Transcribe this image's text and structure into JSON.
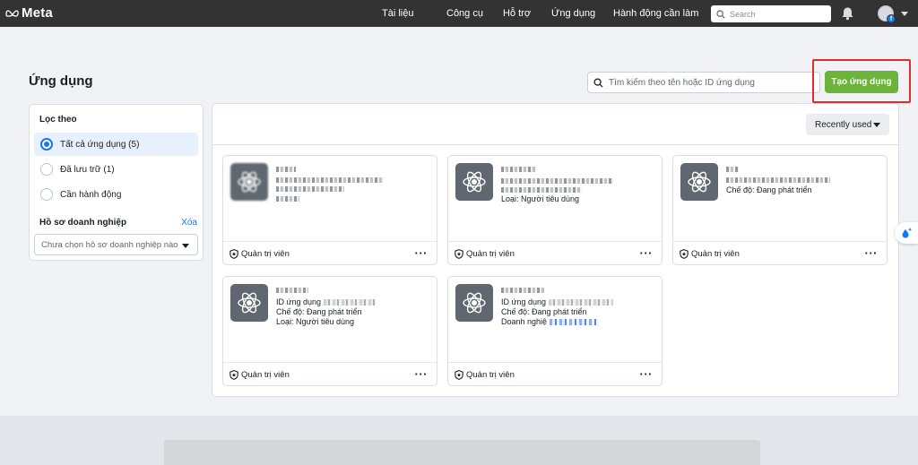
{
  "brand": {
    "name": "Meta"
  },
  "topnav": {
    "links": [
      "Tài liệu",
      "Công cụ",
      "Hỗ trợ",
      "Ứng dụng",
      "Hành động cần làm"
    ],
    "search_placeholder": "Search"
  },
  "page": {
    "title": "Ứng dụng",
    "search_placeholder": "Tìm kiếm theo tên hoặc ID ứng dụng",
    "create_button": "Tạo ứng dụng"
  },
  "filter": {
    "heading": "Lọc theo",
    "options": [
      {
        "label": "Tất cả ứng dụng (5)",
        "selected": true
      },
      {
        "label": "Đã lưu trữ (1)",
        "selected": false
      },
      {
        "label": "Cần hành động",
        "selected": false
      }
    ],
    "business_heading": "Hồ sơ doanh nghiệp",
    "clear_label": "Xóa",
    "business_select": "Chưa chọn hồ sơ doanh nghiệp nào"
  },
  "sort": {
    "label": "Recently used"
  },
  "apps": [
    {
      "lines": [],
      "role": "Quản trị viên"
    },
    {
      "lines": [
        "Loại: Người tiêu dùng"
      ],
      "role": "Quản trị viên"
    },
    {
      "lines": [
        "Chế độ: Đang phát triển"
      ],
      "role": "Quản trị viên"
    },
    {
      "lines": [
        "ID ứng dụng",
        "Chế độ: Đang phát triển",
        "Loại: Người tiêu dùng"
      ],
      "role": "Quản trị viên"
    },
    {
      "lines": [
        "ID ứng dụng",
        "Chế độ: Đang phát triển",
        "Doanh nghiệ"
      ],
      "role": "Quản trị viên"
    }
  ],
  "colors": {
    "accent": "#1877f2",
    "create": "#6bb33b",
    "highlight": "#e02b2b",
    "nav": "#333333"
  }
}
